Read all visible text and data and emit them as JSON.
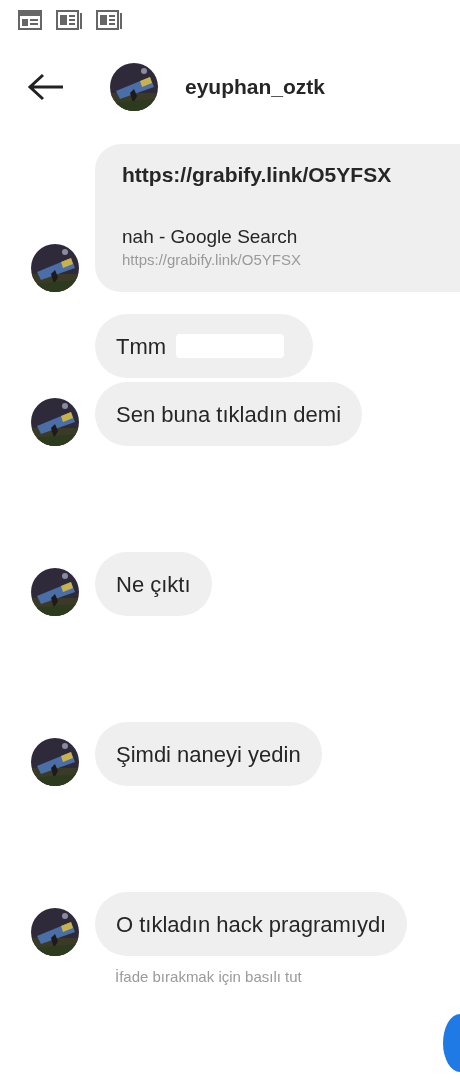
{
  "header": {
    "username": "eyuphan_oztk"
  },
  "messages": [
    {
      "kind": "link",
      "title": "https://grabify.link/O5YFSX",
      "page": "nah - Google Search",
      "url": "https://grabify.link/O5YFSX",
      "avatar": true
    },
    {
      "kind": "text",
      "text": "Tmm",
      "redacted": true,
      "avatar": false
    },
    {
      "kind": "text",
      "text": "Sen buna tıkladın demi",
      "avatar": true
    },
    {
      "kind": "text",
      "text": "Ne çıktı",
      "avatar": true
    },
    {
      "kind": "text",
      "text": "Şimdi naneyi yedin",
      "avatar": true
    },
    {
      "kind": "text",
      "text": "O tıkladın hack pragramıydı",
      "avatar": true
    }
  ],
  "hint": "İfade bırakmak için basılı tut"
}
